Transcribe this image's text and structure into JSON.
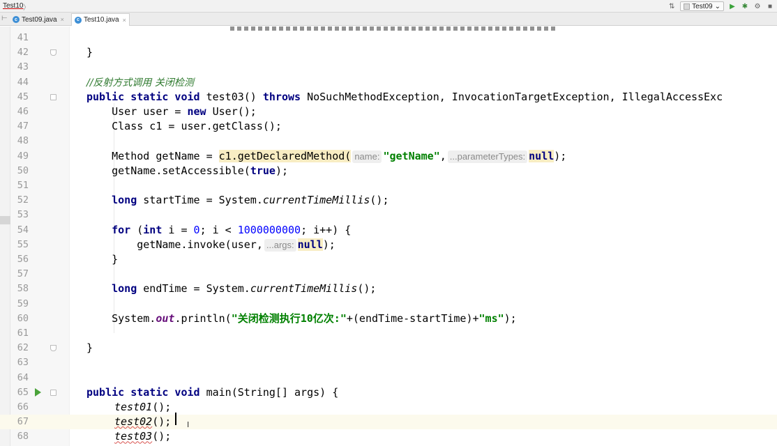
{
  "navbar": {
    "breadcrumb": "Test10",
    "breadcrumb_sep": "〉",
    "run_config": "Test09",
    "icons": [
      "sort-icon",
      "run-icon",
      "debug-icon",
      "coverage-icon",
      "stop-icon"
    ]
  },
  "tabs": [
    {
      "label": "Test09.java",
      "active": false
    },
    {
      "label": "Test10.java",
      "active": true
    }
  ],
  "tab_gutter_glyph": "⊢",
  "tab_close_glyph": "×",
  "tab_icon_letter": "c",
  "editor": {
    "current_line": 67,
    "lines": [
      {
        "n": "41"
      },
      {
        "n": "42",
        "code": "}"
      },
      {
        "n": "43"
      },
      {
        "n": "44",
        "comment": "//反射方式调用 关闭检测"
      },
      {
        "n": "45",
        "kw1": "public static void",
        "name": " test03() ",
        "kw2": "throws",
        "rest": " NoSuchMethodException, InvocationTargetException, IllegalAccessExc"
      },
      {
        "n": "46",
        "a": "    User user = ",
        "kw": "new",
        "b": " User();"
      },
      {
        "n": "47",
        "text": "    Class c1 = user.getClass();"
      },
      {
        "n": "48"
      },
      {
        "n": "49",
        "a": "    Method getName = ",
        "hl": "c1.getDeclaredMethod(",
        "hint1": "name:",
        "str1": "\"getName\"",
        "comma": ",",
        "hint2": "...parameterTypes:",
        "kw": "null",
        "end": ");"
      },
      {
        "n": "50",
        "a": "    getName.setAccessible(",
        "kw": "true",
        "end": ");"
      },
      {
        "n": "51"
      },
      {
        "n": "52",
        "kw": "    long",
        "a": " startTime = System.",
        "it": "currentTimeMillis",
        "end": "();"
      },
      {
        "n": "53"
      },
      {
        "n": "54",
        "kw1": "    for",
        "a": " (",
        "kw2": "int",
        "b": " i = ",
        "n1": "0",
        "c": "; i < ",
        "n2": "1000000000",
        "d": "; i++) {"
      },
      {
        "n": "55",
        "a": "        getName.invoke(user,",
        "hint": "...args:",
        "kw": "null",
        "end": ");"
      },
      {
        "n": "56",
        "text": "    }"
      },
      {
        "n": "57"
      },
      {
        "n": "58",
        "kw": "    long",
        "a": " endTime = System.",
        "it": "currentTimeMillis",
        "end": "();"
      },
      {
        "n": "59"
      },
      {
        "n": "60",
        "a": "    System.",
        "field": "out",
        "b": ".println(",
        "str1": "\"关闭检测执行10亿次:\"",
        "c": "+(endTime-startTime)+",
        "str2": "\"ms\"",
        "end": ");"
      },
      {
        "n": "61"
      },
      {
        "n": "62",
        "code": "}"
      },
      {
        "n": "63"
      },
      {
        "n": "64"
      },
      {
        "n": "65",
        "kw1": "public static void",
        "rest": " main(String[] args) {"
      },
      {
        "n": "66",
        "it": "test01",
        "end": "();"
      },
      {
        "n": "67",
        "it": "test02",
        "end": "();"
      },
      {
        "n": "68",
        "it": "test03",
        "end": "();"
      }
    ]
  },
  "cursor_glyph": "I",
  "colors": {
    "keyword": "#000080",
    "string": "#008000",
    "number": "#0000ff",
    "current_line": "#fcfaed",
    "highlight": "#f8edc3",
    "run_marker": "#4aa33a"
  }
}
